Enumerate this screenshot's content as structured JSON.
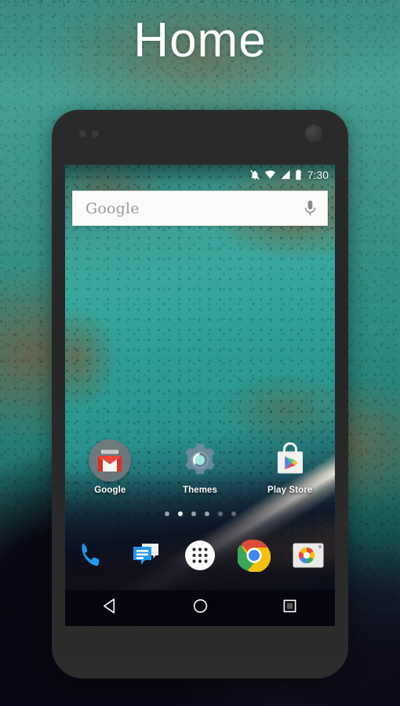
{
  "page": {
    "title": "Home"
  },
  "device": {
    "name": "android-phone-mockup",
    "bezel_color": "#2b2b2b"
  },
  "status_bar": {
    "time": "7:30",
    "icons": [
      {
        "name": "notifications-off-icon",
        "label": "Notifications silenced"
      },
      {
        "name": "wifi-icon",
        "label": "Wi-Fi connected"
      },
      {
        "name": "cell-signal-icon",
        "label": "Cellular signal"
      },
      {
        "name": "battery-icon",
        "label": "Battery"
      }
    ]
  },
  "search": {
    "placeholder": "Google",
    "value": "",
    "voice_icon": "microphone-icon",
    "background": "#fbfbf9",
    "text_color": "#9b9b99"
  },
  "apps": [
    {
      "name": "google",
      "label": "Google",
      "icon": "google-folder-icon"
    },
    {
      "name": "themes",
      "label": "Themes",
      "icon": "gear-icon"
    },
    {
      "name": "play-store",
      "label": "Play Store",
      "icon": "play-store-icon"
    }
  ],
  "page_indicator": {
    "count": 6,
    "active_index": 1
  },
  "dock": [
    {
      "name": "phone",
      "label": "Phone",
      "icon": "phone-icon",
      "color": "#1e9ae8"
    },
    {
      "name": "messages",
      "label": "Messages",
      "icon": "message-bubble-icon",
      "color": "#2196f3"
    },
    {
      "name": "all-apps",
      "label": "All apps",
      "icon": "app-drawer-icon",
      "color": "#ffffff"
    },
    {
      "name": "chrome",
      "label": "Chrome",
      "icon": "chrome-icon",
      "color": "#4285f4"
    },
    {
      "name": "camera",
      "label": "Camera",
      "icon": "camera-icon",
      "color": "#e8e8e8"
    }
  ],
  "nav_bar": [
    {
      "name": "back",
      "label": "Back",
      "icon": "back-triangle-icon"
    },
    {
      "name": "home",
      "label": "Home",
      "icon": "home-circle-icon"
    },
    {
      "name": "recents",
      "label": "Recents",
      "icon": "recents-square-icon"
    }
  ],
  "colors": {
    "wallpaper_teal": "#2fa096",
    "wallpaper_brown": "#8a6a44",
    "wallpaper_deep": "#090a16",
    "title_text": "#ffffff"
  }
}
